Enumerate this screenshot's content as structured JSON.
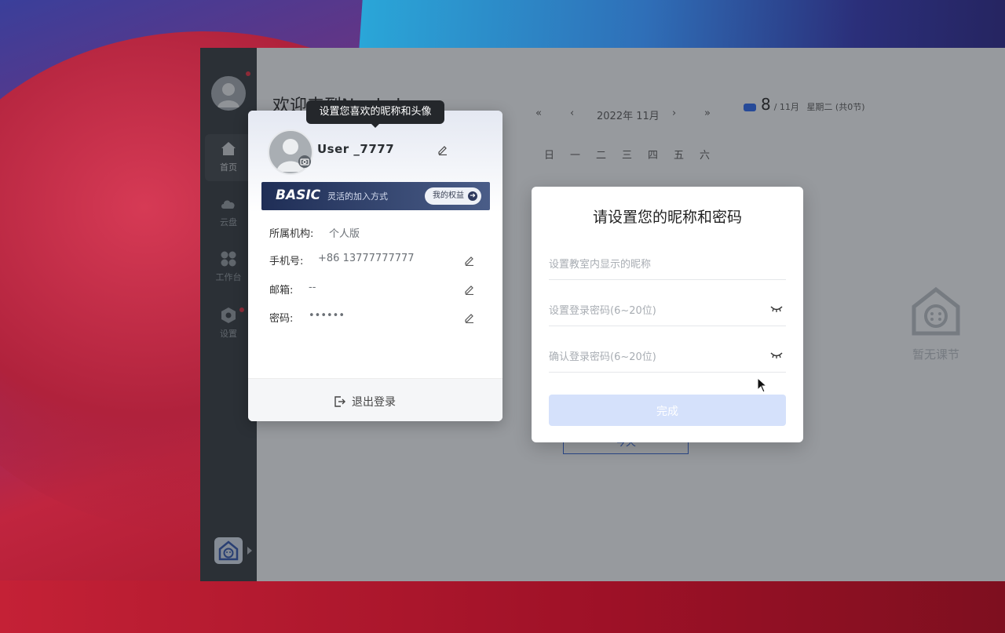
{
  "sidebar": {
    "items": [
      {
        "label": "首页",
        "icon": "home-icon",
        "active": true
      },
      {
        "label": "云盘",
        "icon": "cloud-icon",
        "active": false
      },
      {
        "label": "工作台",
        "icon": "grid-icon",
        "active": false
      },
      {
        "label": "设置",
        "icon": "settings-icon",
        "active": false
      }
    ]
  },
  "main": {
    "welcome": "欢迎来到Nuakol",
    "calendar": {
      "prev_year": "«",
      "prev_month": "‹",
      "month_label": "2022年 11月",
      "next_month": "›",
      "next_year": "»",
      "weekdays": [
        "日",
        "一",
        "二",
        "三",
        "四",
        "五",
        "六"
      ],
      "today_button": "今天"
    },
    "date_badge": {
      "day": "8",
      "month": "/ 11月",
      "weekday": "星期二 (共0节)"
    },
    "empty_state": "暂无课节"
  },
  "profile": {
    "tooltip": "设置您喜欢的昵称和头像",
    "username": "User _7777",
    "plan": {
      "name": "BASIC",
      "subtitle": "灵活的加入方式",
      "benefits_button": "我的权益"
    },
    "rows": [
      {
        "label": "所属机构:",
        "value": "个人版",
        "editable": false
      },
      {
        "label": "手机号:",
        "value": "+86 13777777777",
        "editable": true
      },
      {
        "label": "邮箱:",
        "value": "--",
        "editable": true
      },
      {
        "label": "密码:",
        "value": "••••••",
        "editable": true
      }
    ],
    "logout": "退出登录"
  },
  "dialog": {
    "title": "请设置您的昵称和密码",
    "nickname_placeholder": "设置教室内显示的昵称",
    "password_placeholder": "设置登录密码(6~20位)",
    "confirm_placeholder": "确认登录密码(6~20位)",
    "submit": "完成"
  },
  "colors": {
    "accent": "#2f5fd0",
    "sidebar_bg": "#2f3439",
    "submit_disabled": "#d5e1fb",
    "notification_dot": "#e0283b"
  }
}
